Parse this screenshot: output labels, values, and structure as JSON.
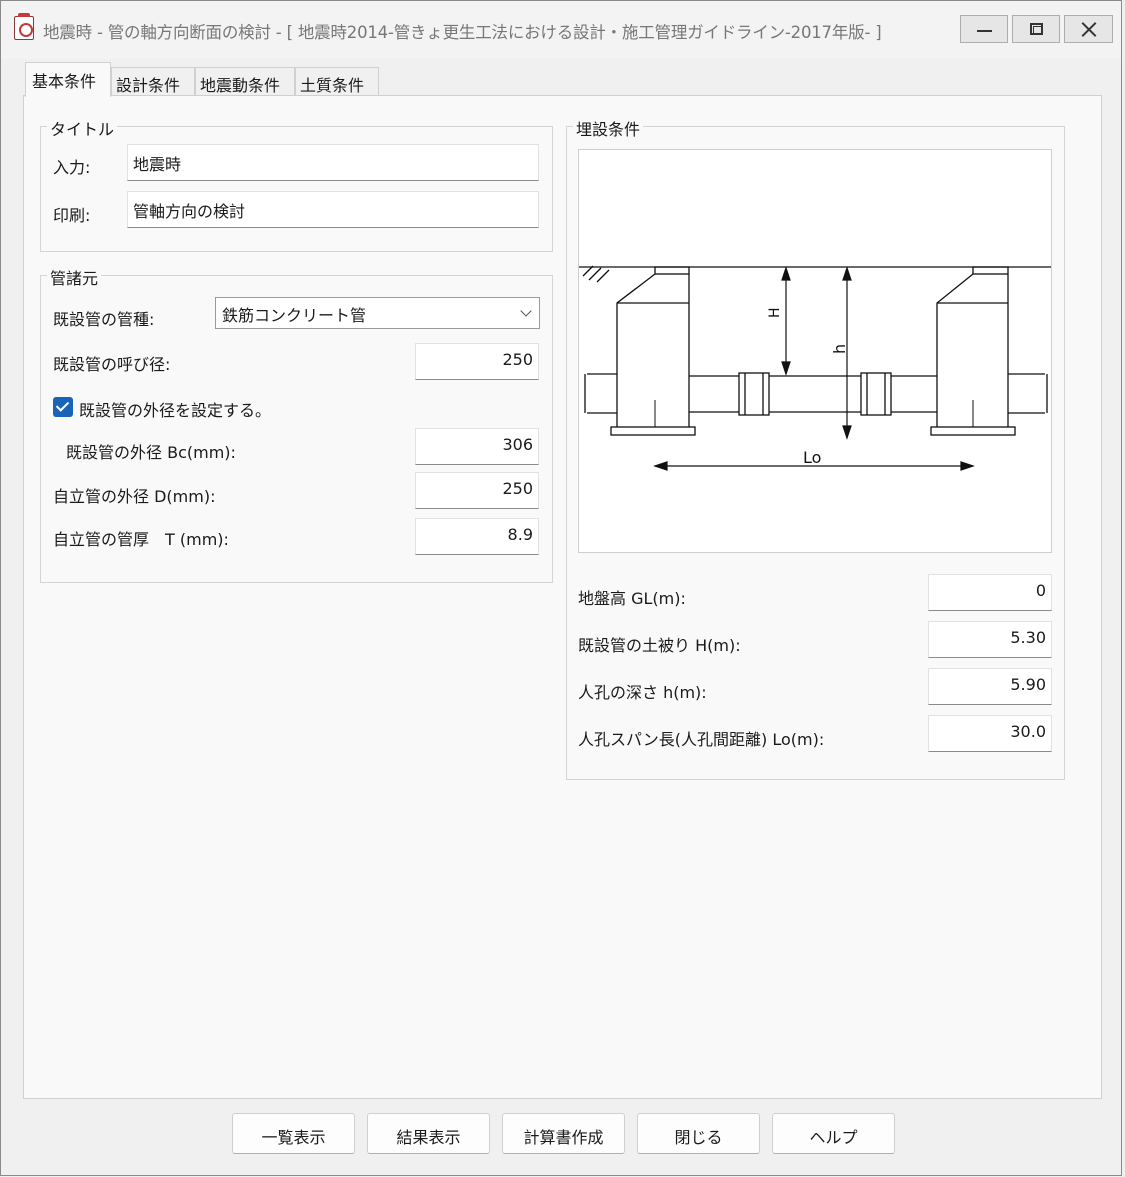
{
  "window": {
    "title": "地震時 - 管の軸方向断面の検討 - [ 地震時2014-管きょ更生工法における設計・施工管理ガイドライン-2017年版- ]"
  },
  "tabs": [
    "基本条件",
    "設計条件",
    "地震動条件",
    "土質条件"
  ],
  "title_group": {
    "label": "タイトル",
    "input_label": "入力:",
    "input_value": "地震時",
    "print_label": "印刷:",
    "print_value": "管軸方向の検討"
  },
  "pipe_group": {
    "label": "管諸元",
    "type_label": "既設管の管種:",
    "type_value": "鉄筋コンクリート管",
    "nominal_label": "既設管の呼び径:",
    "nominal_value": "250",
    "checkbox_label": "既設管の外径を設定する。",
    "checkbox_checked": true,
    "outer_label": "既設管の外径 Bc(mm):",
    "outer_value": "306",
    "self_outer_label": "自立管の外径 D(mm):",
    "self_outer_value": "250",
    "thickness_label": "自立管の管厚　T (mm):",
    "thickness_value": "8.9"
  },
  "burial_group": {
    "label": "埋設条件",
    "diagram_labels": {
      "H": "H",
      "h": "h",
      "Lo": "Lo"
    },
    "gl_label": "地盤高 GL(m):",
    "gl_value": "0",
    "cover_label": "既設管の土被り H(m):",
    "cover_value": "5.30",
    "depth_label": "人孔の深さ h(m):",
    "depth_value": "5.90",
    "span_label": "人孔スパン長(人孔間距離) Lo(m):",
    "span_value": "30.0"
  },
  "buttons": [
    "一覧表示",
    "結果表示",
    "計算書作成",
    "閉じる",
    "ヘルプ"
  ]
}
